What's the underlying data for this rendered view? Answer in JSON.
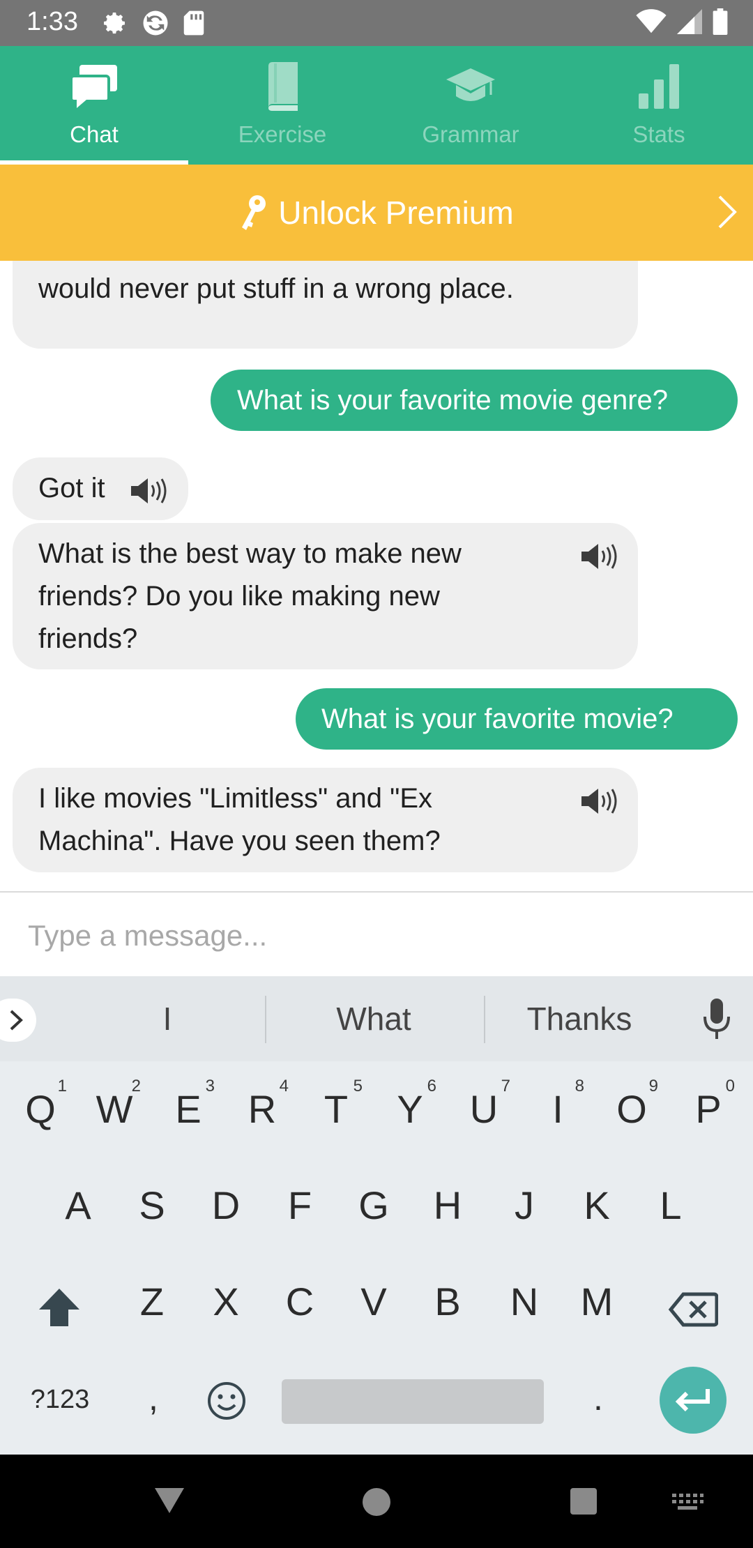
{
  "status_bar": {
    "time": "1:33"
  },
  "tabs": [
    {
      "label": "Chat",
      "icon": "chat-bubbles-icon",
      "active": true
    },
    {
      "label": "Exercise",
      "icon": "book-icon",
      "active": false
    },
    {
      "label": "Grammar",
      "icon": "graduation-cap-icon",
      "active": false
    },
    {
      "label": "Stats",
      "icon": "bar-chart-icon",
      "active": false
    }
  ],
  "premium": {
    "label": "Unlock Premium",
    "icon": "key-icon"
  },
  "messages": [
    {
      "from": "bot",
      "text": "would never put stuff in a wrong place."
    },
    {
      "from": "user",
      "text": "What is your favorite movie genre?"
    },
    {
      "from": "bot",
      "text": "Got it"
    },
    {
      "from": "bot",
      "lines": [
        "What is the best way to make new",
        "friends? Do you like making new",
        "friends?"
      ]
    },
    {
      "from": "user",
      "text": "What is your favorite movie?"
    },
    {
      "from": "bot",
      "lines": [
        "I like movies \"Limitless\" and \"Ex",
        "Machina\". Have you seen them?"
      ]
    }
  ],
  "input": {
    "placeholder": "Type a message..."
  },
  "keyboard": {
    "suggestions": [
      "I",
      "What",
      "Thanks"
    ],
    "row1": [
      "Q",
      "W",
      "E",
      "R",
      "T",
      "Y",
      "U",
      "I",
      "O",
      "P"
    ],
    "row1_hints": [
      "1",
      "2",
      "3",
      "4",
      "5",
      "6",
      "7",
      "8",
      "9",
      "0"
    ],
    "row2": [
      "A",
      "S",
      "D",
      "F",
      "G",
      "H",
      "J",
      "K",
      "L"
    ],
    "row3": [
      "Z",
      "X",
      "C",
      "V",
      "B",
      "N",
      "M"
    ],
    "symbols_key": "?123",
    "comma_key": ",",
    "period_key": "."
  },
  "colors": {
    "primary": "#2fb388",
    "premium": "#f9bf3b",
    "enter": "#4db6ac"
  }
}
